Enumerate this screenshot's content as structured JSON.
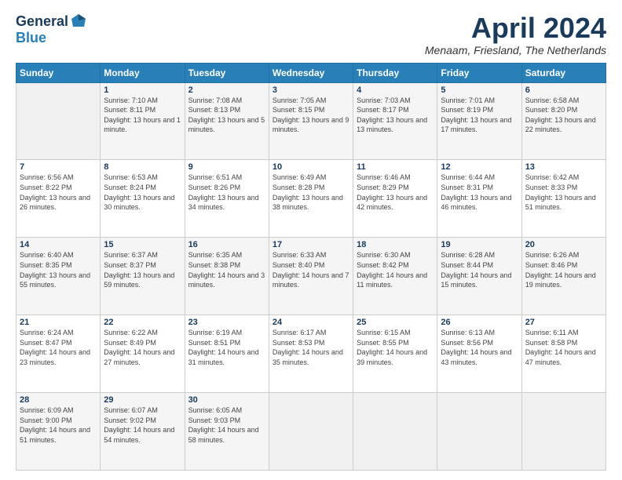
{
  "logo": {
    "general": "General",
    "blue": "Blue"
  },
  "title": "April 2024",
  "location": "Menaam, Friesland, The Netherlands",
  "days_of_week": [
    "Sunday",
    "Monday",
    "Tuesday",
    "Wednesday",
    "Thursday",
    "Friday",
    "Saturday"
  ],
  "weeks": [
    [
      {
        "day": "",
        "sunrise": "",
        "sunset": "",
        "daylight": ""
      },
      {
        "day": "1",
        "sunrise": "Sunrise: 7:10 AM",
        "sunset": "Sunset: 8:11 PM",
        "daylight": "Daylight: 13 hours and 1 minute."
      },
      {
        "day": "2",
        "sunrise": "Sunrise: 7:08 AM",
        "sunset": "Sunset: 8:13 PM",
        "daylight": "Daylight: 13 hours and 5 minutes."
      },
      {
        "day": "3",
        "sunrise": "Sunrise: 7:05 AM",
        "sunset": "Sunset: 8:15 PM",
        "daylight": "Daylight: 13 hours and 9 minutes."
      },
      {
        "day": "4",
        "sunrise": "Sunrise: 7:03 AM",
        "sunset": "Sunset: 8:17 PM",
        "daylight": "Daylight: 13 hours and 13 minutes."
      },
      {
        "day": "5",
        "sunrise": "Sunrise: 7:01 AM",
        "sunset": "Sunset: 8:19 PM",
        "daylight": "Daylight: 13 hours and 17 minutes."
      },
      {
        "day": "6",
        "sunrise": "Sunrise: 6:58 AM",
        "sunset": "Sunset: 8:20 PM",
        "daylight": "Daylight: 13 hours and 22 minutes."
      }
    ],
    [
      {
        "day": "7",
        "sunrise": "Sunrise: 6:56 AM",
        "sunset": "Sunset: 8:22 PM",
        "daylight": "Daylight: 13 hours and 26 minutes."
      },
      {
        "day": "8",
        "sunrise": "Sunrise: 6:53 AM",
        "sunset": "Sunset: 8:24 PM",
        "daylight": "Daylight: 13 hours and 30 minutes."
      },
      {
        "day": "9",
        "sunrise": "Sunrise: 6:51 AM",
        "sunset": "Sunset: 8:26 PM",
        "daylight": "Daylight: 13 hours and 34 minutes."
      },
      {
        "day": "10",
        "sunrise": "Sunrise: 6:49 AM",
        "sunset": "Sunset: 8:28 PM",
        "daylight": "Daylight: 13 hours and 38 minutes."
      },
      {
        "day": "11",
        "sunrise": "Sunrise: 6:46 AM",
        "sunset": "Sunset: 8:29 PM",
        "daylight": "Daylight: 13 hours and 42 minutes."
      },
      {
        "day": "12",
        "sunrise": "Sunrise: 6:44 AM",
        "sunset": "Sunset: 8:31 PM",
        "daylight": "Daylight: 13 hours and 46 minutes."
      },
      {
        "day": "13",
        "sunrise": "Sunrise: 6:42 AM",
        "sunset": "Sunset: 8:33 PM",
        "daylight": "Daylight: 13 hours and 51 minutes."
      }
    ],
    [
      {
        "day": "14",
        "sunrise": "Sunrise: 6:40 AM",
        "sunset": "Sunset: 8:35 PM",
        "daylight": "Daylight: 13 hours and 55 minutes."
      },
      {
        "day": "15",
        "sunrise": "Sunrise: 6:37 AM",
        "sunset": "Sunset: 8:37 PM",
        "daylight": "Daylight: 13 hours and 59 minutes."
      },
      {
        "day": "16",
        "sunrise": "Sunrise: 6:35 AM",
        "sunset": "Sunset: 8:38 PM",
        "daylight": "Daylight: 14 hours and 3 minutes."
      },
      {
        "day": "17",
        "sunrise": "Sunrise: 6:33 AM",
        "sunset": "Sunset: 8:40 PM",
        "daylight": "Daylight: 14 hours and 7 minutes."
      },
      {
        "day": "18",
        "sunrise": "Sunrise: 6:30 AM",
        "sunset": "Sunset: 8:42 PM",
        "daylight": "Daylight: 14 hours and 11 minutes."
      },
      {
        "day": "19",
        "sunrise": "Sunrise: 6:28 AM",
        "sunset": "Sunset: 8:44 PM",
        "daylight": "Daylight: 14 hours and 15 minutes."
      },
      {
        "day": "20",
        "sunrise": "Sunrise: 6:26 AM",
        "sunset": "Sunset: 8:46 PM",
        "daylight": "Daylight: 14 hours and 19 minutes."
      }
    ],
    [
      {
        "day": "21",
        "sunrise": "Sunrise: 6:24 AM",
        "sunset": "Sunset: 8:47 PM",
        "daylight": "Daylight: 14 hours and 23 minutes."
      },
      {
        "day": "22",
        "sunrise": "Sunrise: 6:22 AM",
        "sunset": "Sunset: 8:49 PM",
        "daylight": "Daylight: 14 hours and 27 minutes."
      },
      {
        "day": "23",
        "sunrise": "Sunrise: 6:19 AM",
        "sunset": "Sunset: 8:51 PM",
        "daylight": "Daylight: 14 hours and 31 minutes."
      },
      {
        "day": "24",
        "sunrise": "Sunrise: 6:17 AM",
        "sunset": "Sunset: 8:53 PM",
        "daylight": "Daylight: 14 hours and 35 minutes."
      },
      {
        "day": "25",
        "sunrise": "Sunrise: 6:15 AM",
        "sunset": "Sunset: 8:55 PM",
        "daylight": "Daylight: 14 hours and 39 minutes."
      },
      {
        "day": "26",
        "sunrise": "Sunrise: 6:13 AM",
        "sunset": "Sunset: 8:56 PM",
        "daylight": "Daylight: 14 hours and 43 minutes."
      },
      {
        "day": "27",
        "sunrise": "Sunrise: 6:11 AM",
        "sunset": "Sunset: 8:58 PM",
        "daylight": "Daylight: 14 hours and 47 minutes."
      }
    ],
    [
      {
        "day": "28",
        "sunrise": "Sunrise: 6:09 AM",
        "sunset": "Sunset: 9:00 PM",
        "daylight": "Daylight: 14 hours and 51 minutes."
      },
      {
        "day": "29",
        "sunrise": "Sunrise: 6:07 AM",
        "sunset": "Sunset: 9:02 PM",
        "daylight": "Daylight: 14 hours and 54 minutes."
      },
      {
        "day": "30",
        "sunrise": "Sunrise: 6:05 AM",
        "sunset": "Sunset: 9:03 PM",
        "daylight": "Daylight: 14 hours and 58 minutes."
      },
      {
        "day": "",
        "sunrise": "",
        "sunset": "",
        "daylight": ""
      },
      {
        "day": "",
        "sunrise": "",
        "sunset": "",
        "daylight": ""
      },
      {
        "day": "",
        "sunrise": "",
        "sunset": "",
        "daylight": ""
      },
      {
        "day": "",
        "sunrise": "",
        "sunset": "",
        "daylight": ""
      }
    ]
  ]
}
